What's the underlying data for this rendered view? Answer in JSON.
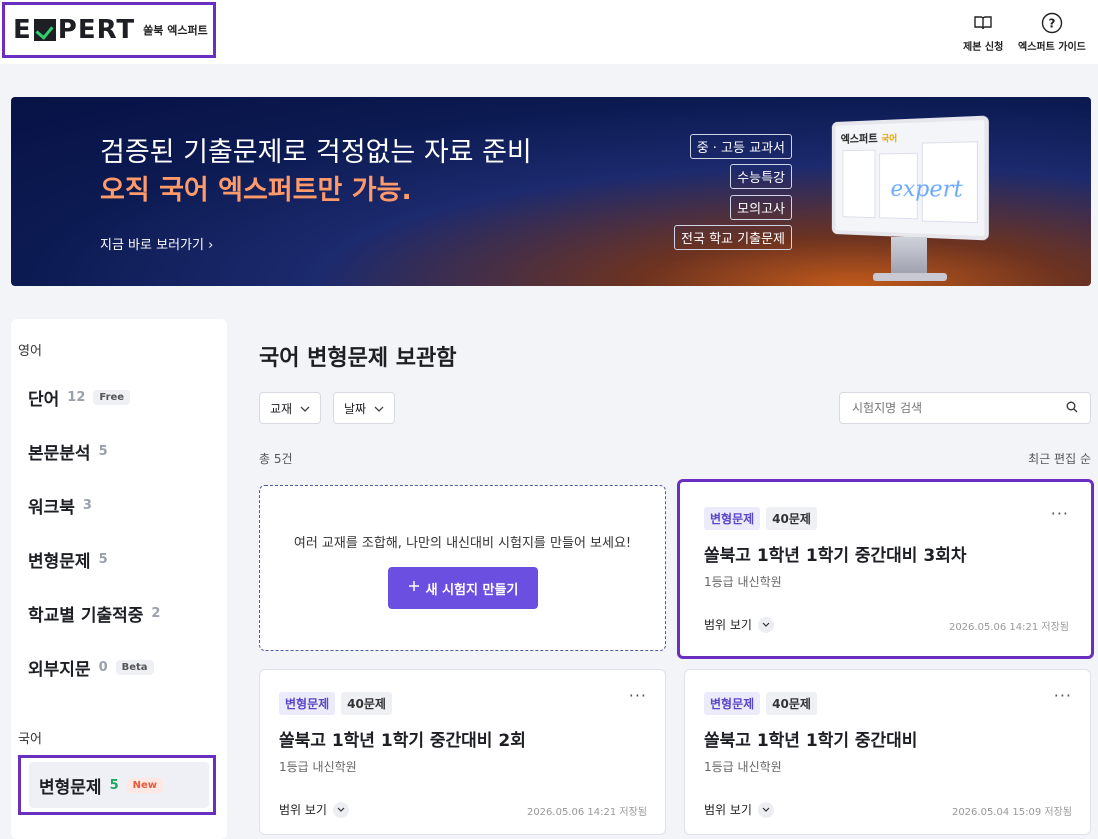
{
  "header": {
    "logo_text_left": "E",
    "logo_text_right": "PERT",
    "logo_sub": "쏠북 엑스퍼트",
    "links": [
      {
        "label": "제본 신청",
        "icon": "book-open-icon"
      },
      {
        "label": "엑스퍼트 가이드",
        "icon": "help-circle-icon"
      }
    ]
  },
  "banner": {
    "line1": "검증된 기출문제로 걱정없는 자료 준비",
    "line2": "오직 국어 엑스퍼트만 가능.",
    "cta": "지금 바로 보러가기 ›",
    "tags": [
      "중 · 고등 교과서",
      "수능특강",
      "모의고사",
      "전국 학교 기출문제"
    ],
    "monitor_title": "엑스퍼트",
    "monitor_title_accent": "국어",
    "monitor_script": "expert"
  },
  "sidebar": {
    "section_english": "영어",
    "english_items": [
      {
        "label": "단어",
        "count": "12",
        "pill": "Free"
      },
      {
        "label": "본문분석",
        "count": "5",
        "pill": ""
      },
      {
        "label": "워크북",
        "count": "3",
        "pill": ""
      },
      {
        "label": "변형문제",
        "count": "5",
        "pill": ""
      },
      {
        "label": "학교별 기출적중",
        "count": "2",
        "pill": ""
      },
      {
        "label": "외부지문",
        "count": "0",
        "pill": "Beta"
      }
    ],
    "section_korean": "국어",
    "korean_items": [
      {
        "label": "변형문제",
        "count": "5",
        "pill": "New"
      }
    ]
  },
  "main": {
    "title": "국어 변형문제 보관함",
    "filters": [
      "교재",
      "날짜"
    ],
    "search_placeholder": "시험지명 검색",
    "total": "총 5건",
    "sort": "최근 편집 순",
    "new_card": {
      "text": "여러 교재를 조합해, 나만의 내신대비 시험지를 만들어 보세요!",
      "button": "새 시험지 만들기"
    },
    "cards": [
      {
        "type": "변형문제",
        "count": "40문제",
        "title": "쏠북고 1학년 1학기 중간대비 3회차",
        "sub": "1등급 내신학원",
        "range": "범위 보기",
        "date": "2026.05.06 14:21 저장됨"
      },
      {
        "type": "변형문제",
        "count": "40문제",
        "title": "쏠북고 1학년 1학기 중간대비 2회",
        "sub": "1등급 내신학원",
        "range": "범위 보기",
        "date": "2026.05.06 14:21 저장됨"
      },
      {
        "type": "변형문제",
        "count": "40문제",
        "title": "쏠북고 1학년 1학기 중간대비",
        "sub": "1등급 내신학원",
        "range": "범위 보기",
        "date": "2026.05.04 15:09 저장됨"
      }
    ],
    "more_label": "···"
  },
  "colors": {
    "accent": "#6b4fe0",
    "highlight": "#6a2ec1",
    "banner_orange": "#ff9a6a"
  }
}
